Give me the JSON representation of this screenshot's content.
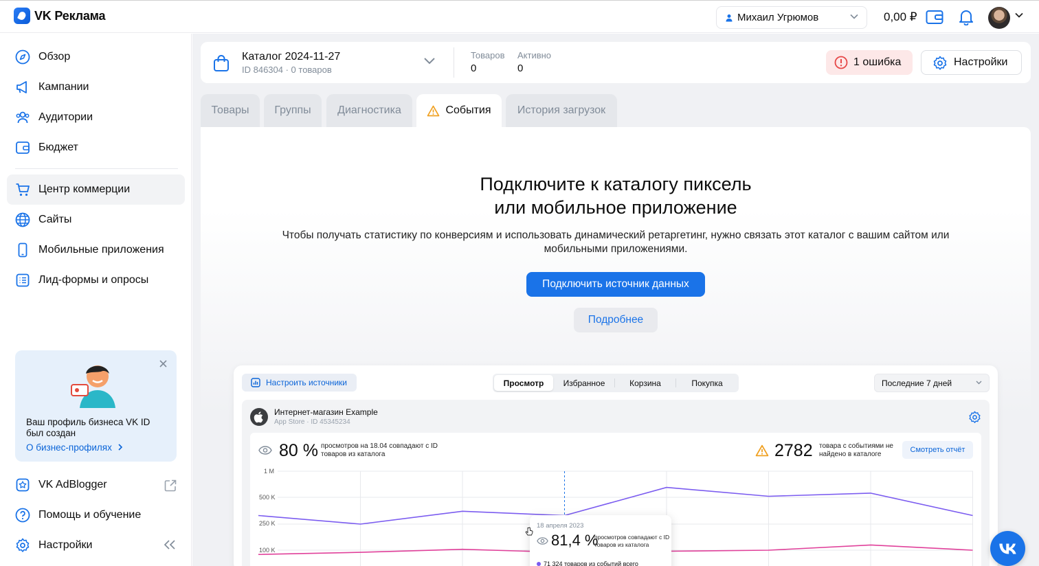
{
  "app": {
    "title": "VK Реклама"
  },
  "header": {
    "account_name": "Михаил Угрюмов",
    "balance": "0,00 ₽"
  },
  "sidebar": {
    "items": [
      {
        "label": "Обзор",
        "icon": "compass-icon"
      },
      {
        "label": "Кампании",
        "icon": "megaphone-icon"
      },
      {
        "label": "Аудитории",
        "icon": "users-icon"
      },
      {
        "label": "Бюджет",
        "icon": "wallet-icon"
      },
      {
        "label": "Центр коммерции",
        "icon": "cart-icon",
        "active": true
      },
      {
        "label": "Сайты",
        "icon": "globe-icon"
      },
      {
        "label": "Мобильные приложения",
        "icon": "phone-icon"
      },
      {
        "label": "Лид-формы и опросы",
        "icon": "list-icon"
      }
    ],
    "promo": {
      "text": "Ваш профиль бизнеса VK ID был создан",
      "link": "О бизнес-профилях"
    },
    "bottom": [
      {
        "label": "VK AdBlogger",
        "icon": "adblogger-icon"
      },
      {
        "label": "Помощь и обучение",
        "icon": "help-icon"
      },
      {
        "label": "Настройки",
        "icon": "gear-icon"
      }
    ]
  },
  "catalog": {
    "title": "Каталог 2024-11-27",
    "subtitle": "ID 846304 · 0 товаров",
    "stats": [
      {
        "label": "Товаров",
        "value": "0"
      },
      {
        "label": "Активно",
        "value": "0"
      }
    ],
    "error_label": "1 ошибка",
    "settings_label": "Настройки"
  },
  "tabs": [
    {
      "label": "Товары"
    },
    {
      "label": "Группы"
    },
    {
      "label": "Диагностика"
    },
    {
      "label": "События",
      "active": true
    },
    {
      "label": "История загрузок"
    }
  ],
  "events": {
    "title_line1": "Подключите к каталогу пиксель",
    "title_line2": "или мобильное приложение",
    "description": "Чтобы получать статистику по конверсиям и использовать динамический ретаргетинг, нужно связать этот каталог с вашим сайтом или мобильными приложениями.",
    "primary_button": "Подключить источник данных",
    "secondary_button": "Подробнее"
  },
  "preview": {
    "sources_button": "Настроить источники",
    "segments": [
      "Просмотр",
      "Избранное",
      "Корзина",
      "Покупка"
    ],
    "period": "Последние 7 дней",
    "app_name": "Интернет-магазин Example",
    "app_sub": "App Store · ID 45345234",
    "metric1_value": "80 %",
    "metric1_text": "просмотров на 18.04 совпадают с ID товаров из каталога",
    "metric2_value": "2782",
    "metric2_text": "товара с событиями не найдено в каталоге",
    "report_button": "Смотреть отчёт",
    "tooltip": {
      "date": "18 апреля 2023",
      "value": "81,4 %",
      "text": "просмотров совпадают с ID товаров из каталога",
      "row": "71 324 товаров из событий всего"
    }
  },
  "chart_data": {
    "type": "line",
    "y_ticks": [
      "1 M",
      "500 K",
      "250 K",
      "100 K"
    ],
    "x": [
      0,
      1,
      2,
      3,
      4,
      5,
      6,
      7
    ],
    "series": [
      {
        "color": "#7b5cf0",
        "values": [
          330000,
          250000,
          370000,
          330000,
          690000,
          520000,
          580000,
          330000
        ]
      },
      {
        "color": "#e0409a",
        "values": [
          80000,
          90000,
          105000,
          90000,
          95000,
          100000,
          130000,
          100000
        ]
      }
    ]
  },
  "colors": {
    "accent": "#1a73e8",
    "error_bg": "#fde8e8"
  }
}
